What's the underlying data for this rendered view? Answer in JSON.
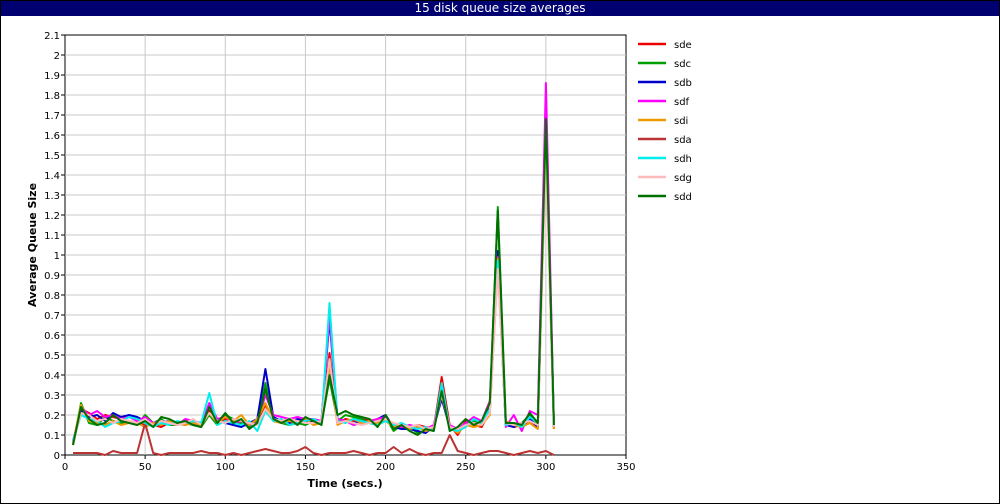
{
  "chart_data": {
    "type": "line",
    "title": "15 disk queue size averages",
    "xlabel": "Time (secs.)",
    "ylabel": "Average Queue Size",
    "xlim": [
      0,
      350
    ],
    "ylim": [
      0,
      2.1
    ],
    "xticks": [
      0,
      50,
      100,
      150,
      200,
      250,
      300,
      350
    ],
    "yticks": [
      0,
      0.1,
      0.2,
      0.3,
      0.4,
      0.5,
      0.6,
      0.7,
      0.8,
      0.9,
      1,
      1.1,
      1.2,
      1.3,
      1.4,
      1.5,
      1.6,
      1.7,
      1.8,
      1.9,
      2,
      2.1
    ],
    "grid": true,
    "legend_position": "right",
    "x": [
      5,
      10,
      15,
      20,
      25,
      30,
      35,
      40,
      45,
      50,
      55,
      60,
      65,
      70,
      75,
      80,
      85,
      90,
      95,
      100,
      105,
      110,
      115,
      120,
      125,
      130,
      135,
      140,
      145,
      150,
      155,
      160,
      165,
      170,
      175,
      180,
      185,
      190,
      195,
      200,
      205,
      210,
      215,
      220,
      225,
      230,
      235,
      240,
      245,
      250,
      255,
      260,
      265,
      270,
      275,
      280,
      285,
      290,
      295,
      300,
      305
    ],
    "series": [
      {
        "name": "sde",
        "color": "#ee0000",
        "values": [
          0.06,
          0.23,
          0.21,
          0.18,
          0.2,
          0.19,
          0.18,
          0.17,
          0.16,
          0.15,
          0.15,
          0.14,
          0.16,
          0.15,
          0.17,
          0.16,
          0.15,
          0.22,
          0.16,
          0.18,
          0.17,
          0.15,
          0.16,
          0.17,
          0.25,
          0.18,
          0.17,
          0.16,
          0.17,
          0.16,
          0.17,
          0.16,
          0.51,
          0.16,
          0.18,
          0.17,
          0.18,
          0.17,
          0.16,
          0.18,
          0.15,
          0.14,
          0.14,
          0.15,
          0.14,
          0.13,
          0.39,
          0.15,
          0.1,
          0.17,
          0.15,
          0.14,
          0.22,
          0.95,
          0.16,
          0.14,
          0.15,
          0.17,
          0.14,
          1.6,
          0.13
        ]
      },
      {
        "name": "sdc",
        "color": "#00a000",
        "values": [
          0.05,
          0.26,
          0.16,
          0.15,
          0.19,
          0.17,
          0.16,
          0.17,
          0.15,
          0.2,
          0.16,
          0.18,
          0.15,
          0.15,
          0.16,
          0.15,
          0.14,
          0.2,
          0.15,
          0.2,
          0.18,
          0.16,
          0.14,
          0.17,
          0.36,
          0.17,
          0.16,
          0.15,
          0.16,
          0.15,
          0.17,
          0.16,
          0.38,
          0.17,
          0.2,
          0.19,
          0.18,
          0.16,
          0.15,
          0.19,
          0.12,
          0.15,
          0.14,
          0.11,
          0.12,
          0.13,
          0.3,
          0.13,
          0.12,
          0.16,
          0.17,
          0.16,
          0.24,
          1.24,
          0.17,
          0.15,
          0.16,
          0.2,
          0.15,
          1.7,
          0.15
        ]
      },
      {
        "name": "sdb",
        "color": "#0000cc",
        "values": [
          0.07,
          0.22,
          0.19,
          0.2,
          0.17,
          0.21,
          0.19,
          0.2,
          0.19,
          0.17,
          0.15,
          0.16,
          0.17,
          0.16,
          0.15,
          0.17,
          0.16,
          0.25,
          0.17,
          0.16,
          0.15,
          0.14,
          0.16,
          0.18,
          0.43,
          0.19,
          0.17,
          0.16,
          0.18,
          0.17,
          0.16,
          0.17,
          0.68,
          0.18,
          0.17,
          0.16,
          0.17,
          0.16,
          0.18,
          0.2,
          0.14,
          0.13,
          0.13,
          0.12,
          0.11,
          0.14,
          0.28,
          0.14,
          0.12,
          0.15,
          0.16,
          0.15,
          0.25,
          1.02,
          0.15,
          0.14,
          0.16,
          0.18,
          0.14,
          1.62,
          0.14
        ]
      },
      {
        "name": "sdf",
        "color": "#ff00ff",
        "values": [
          0.06,
          0.24,
          0.2,
          0.22,
          0.19,
          0.2,
          0.18,
          0.19,
          0.17,
          0.19,
          0.16,
          0.17,
          0.16,
          0.15,
          0.18,
          0.17,
          0.15,
          0.26,
          0.18,
          0.19,
          0.16,
          0.17,
          0.15,
          0.16,
          0.3,
          0.2,
          0.19,
          0.18,
          0.19,
          0.18,
          0.18,
          0.17,
          0.7,
          0.18,
          0.17,
          0.15,
          0.16,
          0.17,
          0.18,
          0.19,
          0.15,
          0.14,
          0.15,
          0.14,
          0.13,
          0.15,
          0.32,
          0.15,
          0.13,
          0.16,
          0.19,
          0.17,
          0.27,
          0.99,
          0.14,
          0.2,
          0.12,
          0.22,
          0.2,
          1.86,
          0.15
        ]
      },
      {
        "name": "sdi",
        "color": "#ee9900",
        "values": [
          0.06,
          0.25,
          0.17,
          0.16,
          0.15,
          0.17,
          0.15,
          0.16,
          0.16,
          0.14,
          0.16,
          0.15,
          0.17,
          0.16,
          0.15,
          0.16,
          0.15,
          0.21,
          0.16,
          0.19,
          0.17,
          0.2,
          0.15,
          0.18,
          0.26,
          0.17,
          0.16,
          0.17,
          0.16,
          0.18,
          0.15,
          0.16,
          0.45,
          0.15,
          0.17,
          0.18,
          0.16,
          0.17,
          0.16,
          0.17,
          0.14,
          0.15,
          0.13,
          0.14,
          0.12,
          0.13,
          0.33,
          0.14,
          0.11,
          0.15,
          0.14,
          0.15,
          0.2,
          0.98,
          0.17,
          0.15,
          0.14,
          0.16,
          0.13,
          1.55,
          0.13
        ]
      },
      {
        "name": "sda",
        "color": "#bb3333",
        "values": [
          0.01,
          0.01,
          0.01,
          0.01,
          0.0,
          0.02,
          0.01,
          0.01,
          0.01,
          0.16,
          0.01,
          0.0,
          0.01,
          0.01,
          0.01,
          0.01,
          0.02,
          0.01,
          0.01,
          0.0,
          0.01,
          0.0,
          0.01,
          0.02,
          0.03,
          0.02,
          0.01,
          0.01,
          0.02,
          0.04,
          0.01,
          0.0,
          0.01,
          0.01,
          0.01,
          0.02,
          0.01,
          0.0,
          0.01,
          0.01,
          0.04,
          0.01,
          0.03,
          0.01,
          0.0,
          0.01,
          0.01,
          0.1,
          0.02,
          0.01,
          0.0,
          0.01,
          0.02,
          0.02,
          0.01,
          0.0,
          0.01,
          0.02,
          0.01,
          0.02,
          0.0
        ]
      },
      {
        "name": "sdh",
        "color": "#00eeee",
        "values": [
          0.07,
          0.2,
          0.18,
          0.17,
          0.14,
          0.16,
          0.17,
          0.19,
          0.18,
          0.16,
          0.14,
          0.16,
          0.15,
          0.17,
          0.16,
          0.17,
          0.16,
          0.31,
          0.15,
          0.17,
          0.16,
          0.15,
          0.17,
          0.12,
          0.22,
          0.17,
          0.18,
          0.15,
          0.16,
          0.17,
          0.18,
          0.16,
          0.76,
          0.17,
          0.16,
          0.18,
          0.17,
          0.16,
          0.15,
          0.17,
          0.15,
          0.16,
          0.14,
          0.13,
          0.14,
          0.12,
          0.36,
          0.13,
          0.12,
          0.14,
          0.18,
          0.16,
          0.23,
          0.97,
          0.15,
          0.16,
          0.14,
          0.19,
          0.16,
          1.58,
          0.14
        ]
      },
      {
        "name": "sdg",
        "color": "#ffbbbb",
        "values": [
          0.06,
          0.21,
          0.2,
          0.17,
          0.18,
          0.16,
          0.18,
          0.17,
          0.16,
          0.18,
          0.15,
          0.17,
          0.16,
          0.15,
          0.16,
          0.18,
          0.15,
          0.21,
          0.17,
          0.16,
          0.18,
          0.17,
          0.16,
          0.15,
          0.23,
          0.18,
          0.17,
          0.18,
          0.17,
          0.16,
          0.16,
          0.17,
          0.48,
          0.16,
          0.17,
          0.16,
          0.15,
          0.16,
          0.17,
          0.18,
          0.16,
          0.15,
          0.14,
          0.15,
          0.13,
          0.14,
          0.3,
          0.14,
          0.13,
          0.15,
          0.16,
          0.15,
          0.21,
          0.93,
          0.16,
          0.15,
          0.16,
          0.17,
          0.15,
          1.5,
          0.14
        ]
      },
      {
        "name": "sdd",
        "color": "#007000",
        "values": [
          0.05,
          0.24,
          0.18,
          0.15,
          0.16,
          0.2,
          0.17,
          0.16,
          0.15,
          0.17,
          0.14,
          0.19,
          0.18,
          0.16,
          0.17,
          0.15,
          0.14,
          0.24,
          0.16,
          0.21,
          0.16,
          0.18,
          0.13,
          0.16,
          0.33,
          0.18,
          0.16,
          0.18,
          0.15,
          0.19,
          0.17,
          0.15,
          0.4,
          0.2,
          0.22,
          0.2,
          0.19,
          0.18,
          0.14,
          0.2,
          0.13,
          0.15,
          0.12,
          0.1,
          0.13,
          0.12,
          0.32,
          0.12,
          0.14,
          0.18,
          0.15,
          0.17,
          0.26,
          1.22,
          0.16,
          0.16,
          0.15,
          0.21,
          0.16,
          1.68,
          0.15
        ]
      }
    ]
  }
}
